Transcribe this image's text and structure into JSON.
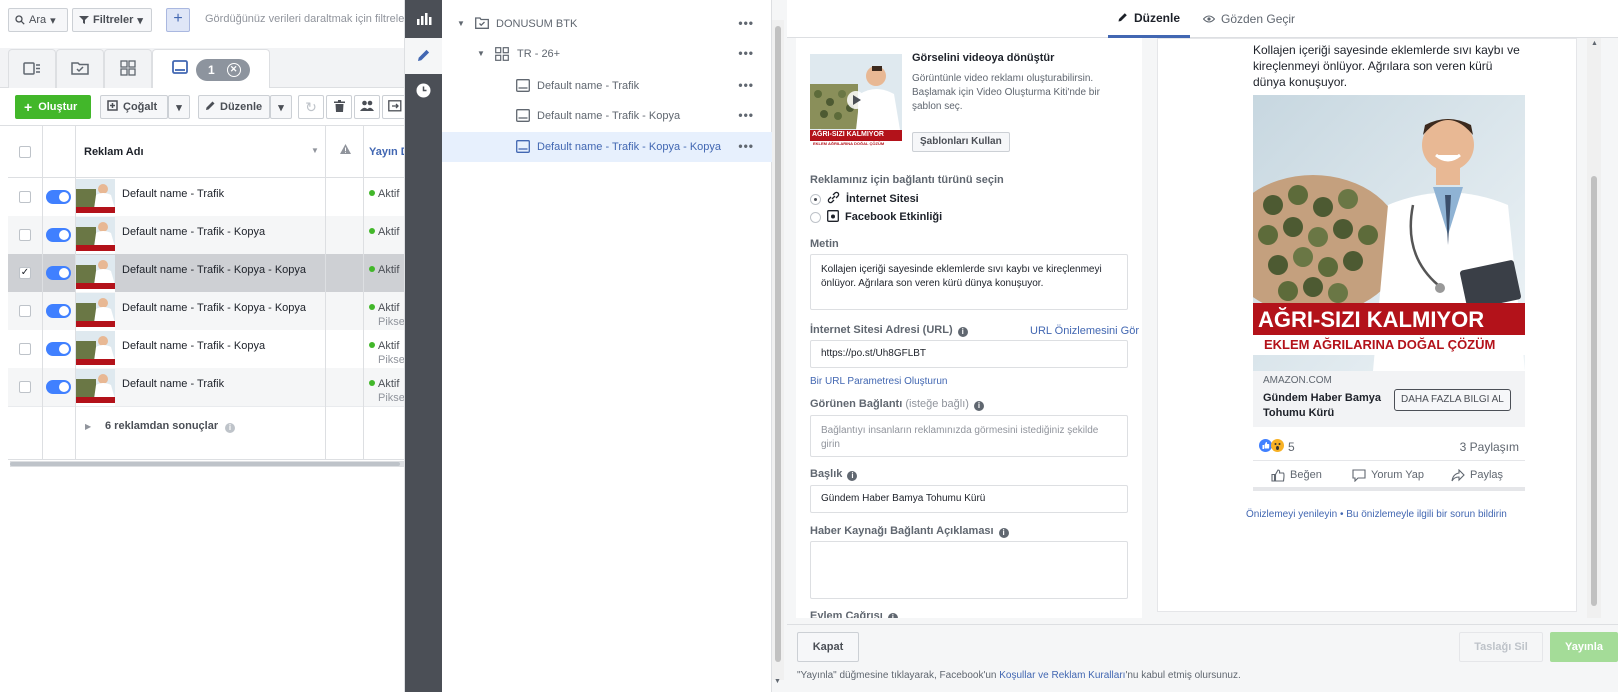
{
  "toolbar": {
    "search_label": "Ara",
    "filters_label": "Filtreler",
    "filter_hint": "Gördüğünüz verileri daraltmak için filtrele"
  },
  "tabs": {
    "selected_count": "1"
  },
  "actions": {
    "create_label": "Oluştur",
    "duplicate_label": "Çoğalt",
    "edit_label": "Düzenle"
  },
  "table": {
    "col_name": "Reklam Adı",
    "col_status": "Yayın D",
    "rows": [
      {
        "name": "Default name - Trafik",
        "status": "Aktif",
        "sub": ""
      },
      {
        "name": "Default name - Trafik - Kopya",
        "status": "Aktif",
        "sub": ""
      },
      {
        "name": "Default name - Trafik - Kopya - Kopya",
        "status": "Aktif",
        "sub": ""
      },
      {
        "name": "Default name - Trafik - Kopya - Kopya",
        "status": "Aktif",
        "sub": "Piksel"
      },
      {
        "name": "Default name - Trafik - Kopya",
        "status": "Aktif",
        "sub": "Piksel"
      },
      {
        "name": "Default name - Trafik",
        "status": "Aktif",
        "sub": "Piksel"
      }
    ],
    "summary": "6 reklamdan sonuçlar"
  },
  "tree": {
    "campaign": "DONUSUM BTK",
    "adset": "TR - 26+",
    "ads": [
      "Default name - Trafik",
      "Default name - Trafik - Kopya",
      "Default name - Trafik - Kopya - Kopya"
    ]
  },
  "editor": {
    "tab_edit": "Düzenle",
    "tab_review": "Gözden Geçir",
    "video_title": "Görselini videoya dönüştür",
    "video_desc": "Görüntünle video reklamı oluşturabilirsin. Başlamak için Video Oluşturma Kiti'nde bir şablon seç.",
    "templates_button": "Şablonları Kullan",
    "link_type_label": "Reklamınız için bağlantı türünü seçin",
    "option_website": "İnternet Sitesi",
    "option_facebook": "Facebook Etkinliği",
    "text_label": "Metin",
    "text_value": "Kollajen içeriği sayesinde eklemlerde sıvı kaybı ve kireçlenmeyi önlüyor. Ağrılara son veren kürü dünya konuşuyor.",
    "url_label": "İnternet Sitesi Adresi (URL)",
    "url_preview_link": "URL Önizlemesini Gör",
    "url_value": "https://po.st/Uh8GFLBT",
    "url_params_link": "Bir URL Parametresi Oluşturun",
    "display_link_label": "Görünen Bağlantı",
    "display_link_optional": "(isteğe bağlı)",
    "display_link_placeholder": "Bağlantıyı insanların reklamınızda görmesini istediğiniz şekilde girin",
    "headline_label": "Başlık",
    "headline_value": "Gündem Haber Bamya Tohumu Kürü",
    "news_desc_label": "Haber Kaynağı Bağlantı Açıklaması",
    "cta_label": "Eylem Çağrısı"
  },
  "preview": {
    "text_top": "Kollajen içeriği sayesinde eklemlerde sıvı kaybı ve kireçlenmeyi önlüyor. Ağrılara son veren kürü dünya konuşuyor.",
    "banner_title": "AĞRI-SIZI KALMIYOR",
    "banner_sub": "EKLEM AĞRILARINA DOĞAL ÇÖZÜM",
    "thumb_banner_title": "AĞRI-SIZI KALMIYOR",
    "thumb_banner_sub": "EKLEM AĞRILARINA DOĞAL ÇÖZÜM",
    "domain": "AMAZON.COM",
    "headline": "Gündem Haber Bamya Tohumu Kürü",
    "cta_button": "DAHA FAZLA BILGI AL",
    "reactions_count": "5",
    "shares": "3 Paylaşım",
    "like": "Beğen",
    "comment": "Yorum Yap",
    "share": "Paylaş",
    "refresh_link": "Önizlemeyi yenileyin",
    "separator": "•",
    "report_link": "Bu önizlemeyle ilgili bir sorun bildirin"
  },
  "footer": {
    "close": "Kapat",
    "delete_draft": "Taslağı Sil",
    "publish": "Yayınla",
    "legal_prefix": "\"Yayınla\" düğmesine tıklayarak, Facebook'un ",
    "legal_link": "Koşullar ve Reklam Kuralları",
    "legal_suffix": "'nu kabul etmiş olursunuz."
  },
  "colors": {
    "accent": "#4267b2",
    "create": "#42b72a",
    "banner_red": "#b3121a",
    "toggle": "#4080ff"
  }
}
